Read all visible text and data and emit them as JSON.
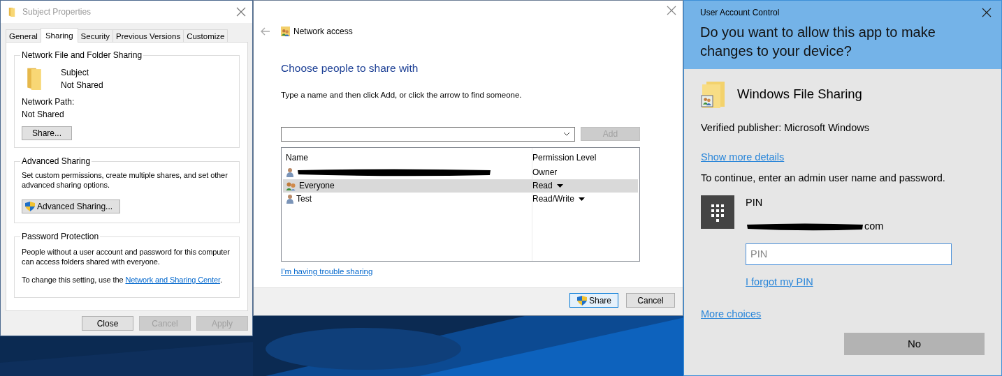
{
  "properties_window": {
    "title": "Subject Properties",
    "tabs": [
      {
        "label": "General",
        "selected": false
      },
      {
        "label": "Sharing",
        "selected": true
      },
      {
        "label": "Security",
        "selected": false
      },
      {
        "label": "Previous Versions",
        "selected": false
      },
      {
        "label": "Customize",
        "selected": false
      }
    ],
    "network_sharing": {
      "heading": "Network File and Folder Sharing",
      "folder_name": "Subject",
      "folder_status": "Not Shared",
      "path_label": "Network Path:",
      "path_value": "Not Shared",
      "button": "Share..."
    },
    "advanced_sharing": {
      "heading": "Advanced Sharing",
      "description": "Set custom permissions, create multiple shares, and set other advanced sharing options.",
      "button": "Advanced Sharing..."
    },
    "password_protection": {
      "heading": "Password Protection",
      "description": "People without a user account and password for this computer can access folders shared with everyone.",
      "link_prefix": "To change this setting, use the ",
      "link": "Network and Sharing Center",
      "link_suffix": "."
    },
    "buttons": [
      {
        "label": "Close",
        "disabled": false
      },
      {
        "label": "Cancel",
        "disabled": true
      },
      {
        "label": "Apply",
        "disabled": true
      }
    ]
  },
  "network_access_window": {
    "title": "Network access",
    "heading": "Choose people to share with",
    "instruction": "Type a name and then click Add, or click the arrow to find someone.",
    "add_button": {
      "label": "Add",
      "disabled": true
    },
    "table": {
      "columns": [
        "Name",
        "Permission Level"
      ],
      "rows": [
        {
          "kind": "user",
          "redacted": true,
          "permission": "Owner",
          "dropdown": false,
          "selected": false
        },
        {
          "kind": "group",
          "redacted": false,
          "name": "Everyone",
          "permission": "Read",
          "dropdown": true,
          "selected": true
        },
        {
          "kind": "user",
          "redacted": false,
          "name": "Test",
          "permission": "Read/Write",
          "dropdown": true,
          "selected": false
        }
      ]
    },
    "help_link": "I'm having trouble sharing",
    "buttons": [
      {
        "label": "Share",
        "shield": true,
        "default": true
      },
      {
        "label": "Cancel",
        "shield": false,
        "default": false
      }
    ]
  },
  "uac_window": {
    "title": "User Account Control",
    "question": "Do you want to allow this app to make changes to your device?",
    "app_name": "Windows File Sharing",
    "publisher": "Verified publisher: Microsoft Windows",
    "details_link": "Show more details",
    "instruction": "To continue, enter an admin user name and password.",
    "credential": {
      "label": "PIN",
      "account_redacted": true,
      "account_visible": "com"
    },
    "pin_field": {
      "placeholder": "PIN"
    },
    "forgot_link": "I forgot my PIN",
    "more_choices": "More choices",
    "buttons": [
      {
        "label": "No"
      }
    ]
  }
}
